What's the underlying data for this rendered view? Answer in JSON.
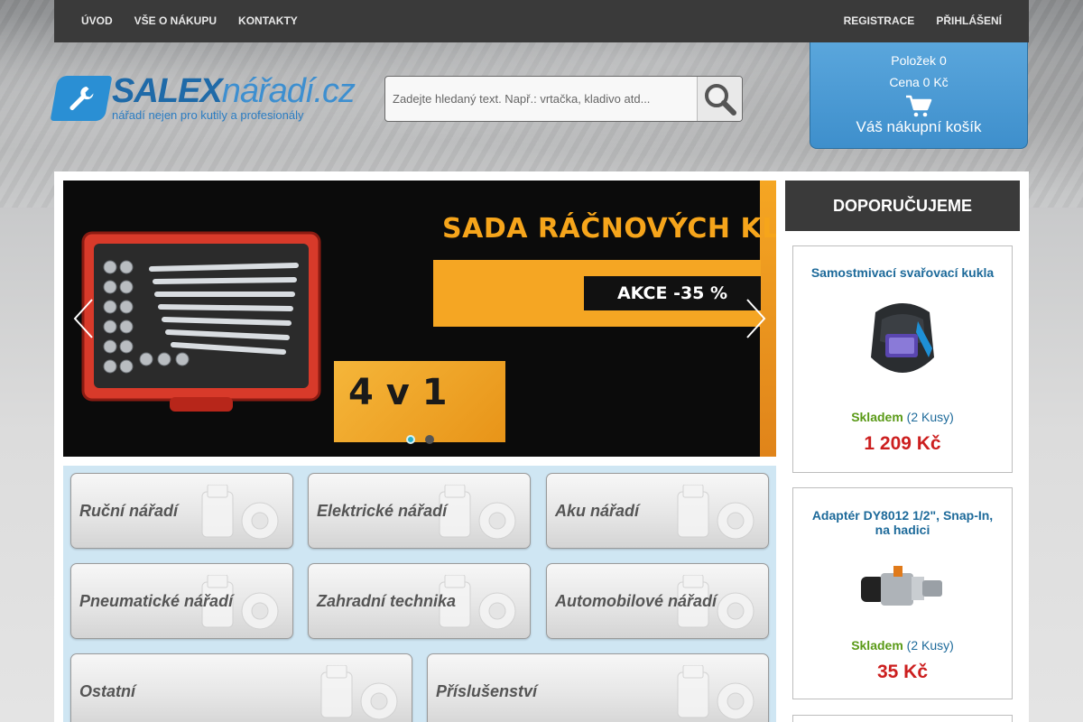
{
  "topnav": {
    "left": [
      {
        "label": "ÚVOD"
      },
      {
        "label": "VŠE O NÁKUPU"
      },
      {
        "label": "KONTAKTY"
      }
    ],
    "right": [
      {
        "label": "REGISTRACE"
      },
      {
        "label": "PŘIHLÁŠENÍ"
      }
    ]
  },
  "logo": {
    "brand": "SALEX",
    "domain": "nářadí.cz",
    "tagline": "nářadí nejen pro kutily a profesionály"
  },
  "search": {
    "placeholder": "Zadejte hledaný text. Např.: vrtačka, kladivo atd..."
  },
  "cart": {
    "items_line": "Položek 0",
    "price_line": "Cena 0 Kč",
    "label": "Váš nákupní košík"
  },
  "slider": {
    "headline": "SADA RÁČNOVÝCH KLÍČŮ",
    "promo": "AKCE -35 %",
    "badge": "4 v 1",
    "active_slide": 1,
    "slide_count": 2
  },
  "categories": [
    {
      "label": "Ruční nářadí"
    },
    {
      "label": "Elektrické nářadí"
    },
    {
      "label": "Aku nářadí"
    },
    {
      "label": "Pneumatické nářadí"
    },
    {
      "label": "Zahradní technika"
    },
    {
      "label": "Automobilové nářadí"
    },
    {
      "label": "Ostatní"
    },
    {
      "label": "Příslušenství"
    }
  ],
  "recommended": {
    "heading": "DOPORUČUJEME",
    "products": [
      {
        "title": "Samostmivací svařovací kukla",
        "stock_label": "Skladem",
        "stock_qty": "(2 Kusy)",
        "price": "1 209 Kč"
      },
      {
        "title": "Adaptér DY8012 1/2\", Snap-In, na hadici",
        "stock_label": "Skladem",
        "stock_qty": "(2 Kusy)",
        "price": "35 Kč"
      }
    ]
  },
  "colors": {
    "nav_bg": "#3a3a3a",
    "brand_blue": "#2a8fd4",
    "cart_blue": "#4a9bd6",
    "price_red": "#cc1f1f",
    "stock_green": "#5a9a17",
    "promo_orange": "#f5a623"
  },
  "icons": {
    "search": "magnifier-icon",
    "cart": "shopping-cart-icon",
    "logo": "wrench-icon",
    "slider_prev": "chevron-left-icon",
    "slider_next": "chevron-right-icon",
    "category": "socket-icon"
  }
}
